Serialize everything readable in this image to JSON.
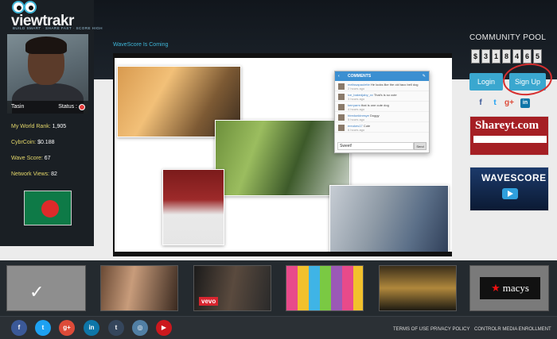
{
  "brand": {
    "logo_text": "viewtrakr",
    "tagline": "BUILD SMART · SHARE FAST · SCORE HIGH"
  },
  "profile": {
    "name": "Tasin",
    "status_label": "Status :",
    "status_color": "#e53b3b"
  },
  "stats": [
    {
      "key": "My World Rank:",
      "value": "1,905"
    },
    {
      "key": "CybrCoin:",
      "value": "$0.188"
    },
    {
      "key": "Wave Score:",
      "value": "67"
    },
    {
      "key": "Network Views:",
      "value": "82"
    }
  ],
  "banner": {
    "title": "WaveScore Is Coming",
    "comments": {
      "header": "COMMENTS",
      "back_icon": "‹",
      "edit_icon": "✎",
      "rows": [
        {
          "user": "melissapaulette",
          "text": "He looks like the old taco bell dog",
          "time": "2 hours ago"
        },
        {
          "user": "ice_bakedjaby_xx",
          "text": "That's is so cute",
          "time": "3 hours ago"
        },
        {
          "user": "kerryarm",
          "text": "that is one cute dog",
          "time": "4 hours ago"
        },
        {
          "user": "hiredunkinesye",
          "text": "Doggy",
          "time": "5 hours ago"
        },
        {
          "user": "ereukes17",
          "text": "Cute",
          "time": "6 hours ago"
        }
      ],
      "input_value": "Sweet!",
      "send_label": "Send"
    }
  },
  "community": {
    "title": "COMMUNITY POOL",
    "digits": [
      "$",
      "3",
      "1",
      "8",
      "4",
      "6",
      "5"
    ]
  },
  "auth": {
    "login_label": "Login",
    "signup_label": "Sign Up",
    "accent": "#3aa7cf",
    "circle_color": "#d62f2f"
  },
  "social_small": [
    {
      "glyph": "f",
      "color": "#3b5998",
      "name": "facebook"
    },
    {
      "glyph": "t",
      "color": "#1da1f2",
      "name": "twitter"
    },
    {
      "glyph": "g+",
      "color": "#dd4b39",
      "name": "google-plus"
    },
    {
      "glyph": "in",
      "color": "#0e76a8",
      "name": "linkedin"
    }
  ],
  "ads": {
    "shareyt": "Shareyt.com",
    "wavescore": "WAVESCORE"
  },
  "thumbs": {
    "nike": "✓",
    "vevo": "vevo",
    "macys": "macys"
  },
  "footer": {
    "icons": [
      {
        "glyph": "f",
        "color": "#3b5998",
        "name": "facebook"
      },
      {
        "glyph": "t",
        "color": "#1da1f2",
        "name": "twitter"
      },
      {
        "glyph": "g+",
        "color": "#dd4b39",
        "name": "google-plus"
      },
      {
        "glyph": "in",
        "color": "#0e76a8",
        "name": "linkedin"
      },
      {
        "glyph": "t",
        "color": "#35465c",
        "name": "tumblr"
      },
      {
        "glyph": "◎",
        "color": "#517fa4",
        "name": "instagram"
      },
      {
        "glyph": "▶",
        "color": "#cc181e",
        "name": "youtube"
      }
    ],
    "links": [
      "TERMS OF USE",
      "PRIVACY POLICY",
      "CONTROLR MEDIA ENROLLMENT"
    ]
  }
}
